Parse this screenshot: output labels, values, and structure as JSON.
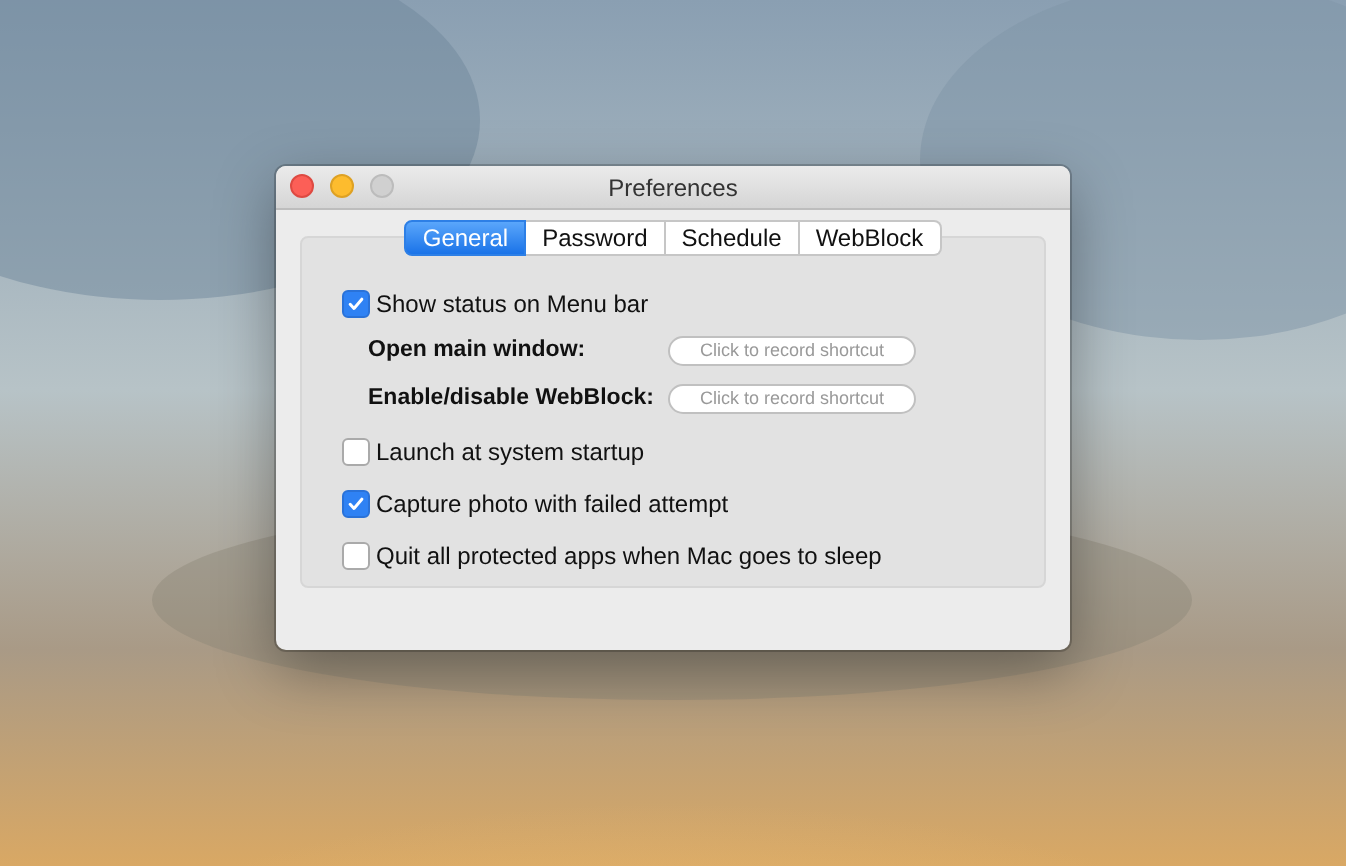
{
  "window": {
    "title": "Preferences"
  },
  "tabs": [
    {
      "label": "General",
      "selected": true
    },
    {
      "label": "Password",
      "selected": false
    },
    {
      "label": "Schedule",
      "selected": false
    },
    {
      "label": "WebBlock",
      "selected": false
    }
  ],
  "items": [
    {
      "kind": "checkbox",
      "label": "Show status on Menu bar",
      "checked": true
    },
    {
      "kind": "shortcut",
      "label": "Open main window:",
      "placeholder": "Click to record shortcut"
    },
    {
      "kind": "shortcut",
      "label": "Enable/disable WebBlock:",
      "placeholder": "Click to record shortcut"
    },
    {
      "kind": "checkbox",
      "label": "Launch at system startup",
      "checked": false
    },
    {
      "kind": "checkbox",
      "label": "Capture photo with failed attempt",
      "checked": true
    },
    {
      "kind": "checkbox",
      "label": "Quit all protected apps when Mac goes to sleep",
      "checked": false
    }
  ]
}
